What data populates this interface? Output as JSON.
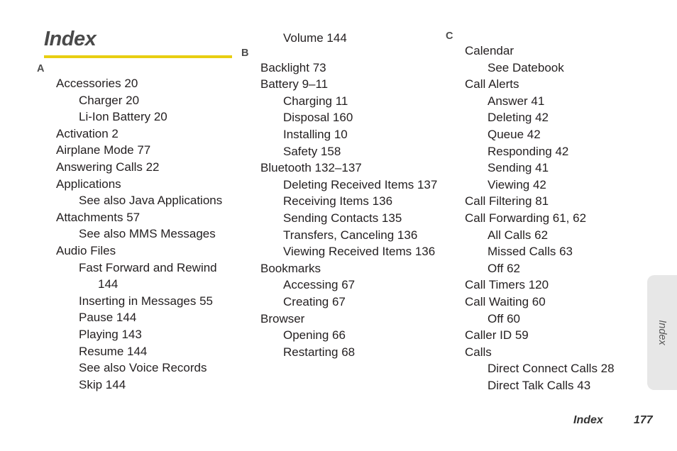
{
  "document": {
    "title": "Index",
    "accent_color": "#e8ce12",
    "text_color": "#231f20",
    "letter_color": "#4d4d4d"
  },
  "side_tab": {
    "label": "Index",
    "background_color": "#e7e7e7"
  },
  "footer": {
    "label": "Index",
    "page_number": "177"
  },
  "columns": [
    {
      "id": "column-1",
      "blocks": [
        {
          "letter": "A",
          "entries": [
            {
              "level": 1,
              "text": "Accessories 20"
            },
            {
              "level": 2,
              "text": "Charger 20"
            },
            {
              "level": 2,
              "text": "Li-Ion Battery 20"
            },
            {
              "level": 1,
              "text": "Activation 2"
            },
            {
              "level": 1,
              "text": "Airplane Mode 77"
            },
            {
              "level": 1,
              "text": "Answering Calls 22"
            },
            {
              "level": 1,
              "text": "Applications"
            },
            {
              "level": 2,
              "text": "See also Java Applications"
            },
            {
              "level": 1,
              "text": "Attachments 57"
            },
            {
              "level": 2,
              "text": "See also MMS Messages"
            },
            {
              "level": 1,
              "text": "Audio Files"
            },
            {
              "level": 2,
              "text": "Fast Forward and Rewind"
            },
            {
              "level": 3,
              "text": "144"
            },
            {
              "level": 2,
              "text": "Inserting in Messages 55"
            },
            {
              "level": 2,
              "text": "Pause 144"
            },
            {
              "level": 2,
              "text": "Playing 143"
            },
            {
              "level": 2,
              "text": "Resume 144"
            },
            {
              "level": 2,
              "text": "See also Voice Records"
            },
            {
              "level": 2,
              "text": "Skip 144"
            }
          ]
        }
      ]
    },
    {
      "id": "column-2",
      "continuation": [
        {
          "level": 2,
          "text": "Volume 144"
        }
      ],
      "blocks": [
        {
          "letter": "B",
          "entries": [
            {
              "level": 1,
              "text": "Backlight 73"
            },
            {
              "level": 1,
              "text": "Battery 9–11"
            },
            {
              "level": 2,
              "text": "Charging 11"
            },
            {
              "level": 2,
              "text": "Disposal 160"
            },
            {
              "level": 2,
              "text": "Installing 10"
            },
            {
              "level": 2,
              "text": "Safety 158"
            },
            {
              "level": 1,
              "text": "Bluetooth 132–137"
            },
            {
              "level": 2,
              "text": "Deleting Received Items 137"
            },
            {
              "level": 2,
              "text": "Receiving Items 136"
            },
            {
              "level": 2,
              "text": "Sending Contacts 135"
            },
            {
              "level": 2,
              "text": "Transfers, Canceling 136"
            },
            {
              "level": 2,
              "text": "Viewing Received Items 136"
            },
            {
              "level": 1,
              "text": "Bookmarks"
            },
            {
              "level": 2,
              "text": "Accessing 67"
            },
            {
              "level": 2,
              "text": "Creating 67"
            },
            {
              "level": 1,
              "text": "Browser"
            },
            {
              "level": 2,
              "text": "Opening 66"
            },
            {
              "level": 2,
              "text": "Restarting 68"
            }
          ]
        }
      ]
    },
    {
      "id": "column-3",
      "continuation": [],
      "blocks": [
        {
          "letter": "C",
          "entries": [
            {
              "level": 1,
              "text": "Calendar"
            },
            {
              "level": 2,
              "text": "See Datebook"
            },
            {
              "level": 1,
              "text": "Call Alerts"
            },
            {
              "level": 2,
              "text": "Answer 41"
            },
            {
              "level": 2,
              "text": "Deleting 42"
            },
            {
              "level": 2,
              "text": "Queue 42"
            },
            {
              "level": 2,
              "text": "Responding 42"
            },
            {
              "level": 2,
              "text": "Sending 41"
            },
            {
              "level": 2,
              "text": "Viewing 42"
            },
            {
              "level": 1,
              "text": "Call Filtering 81"
            },
            {
              "level": 1,
              "text": "Call Forwarding 61, 62"
            },
            {
              "level": 2,
              "text": "All Calls 62"
            },
            {
              "level": 2,
              "text": "Missed Calls 63"
            },
            {
              "level": 2,
              "text": "Off 62"
            },
            {
              "level": 1,
              "text": "Call Timers 120"
            },
            {
              "level": 1,
              "text": "Call Waiting 60"
            },
            {
              "level": 2,
              "text": "Off 60"
            },
            {
              "level": 1,
              "text": "Caller ID 59"
            },
            {
              "level": 1,
              "text": "Calls"
            },
            {
              "level": 2,
              "text": "Direct Connect Calls 28"
            },
            {
              "level": 2,
              "text": "Direct Talk Calls 43"
            }
          ]
        }
      ]
    }
  ]
}
